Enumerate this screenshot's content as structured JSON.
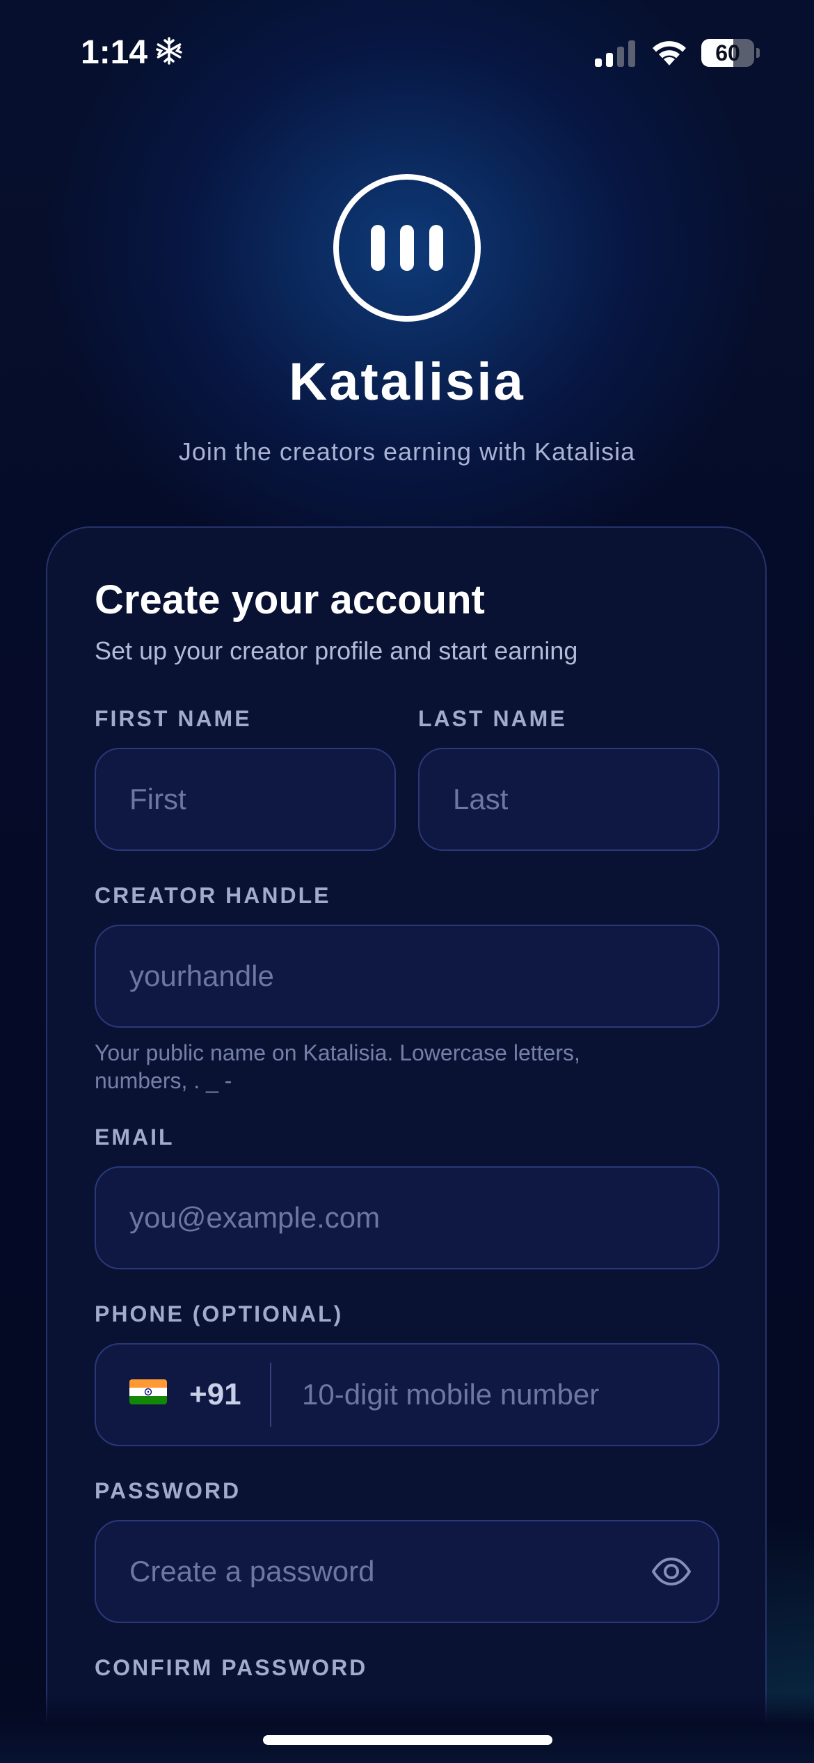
{
  "status_bar": {
    "time": "1:14",
    "battery_level": "60",
    "battery_fraction": 0.6
  },
  "brand": {
    "name": "Katalisia",
    "tagline": "Join the creators earning with Katalisia",
    "logo_icon": "pause-bars-logo-icon"
  },
  "form": {
    "title": "Create your account",
    "subtitle": "Set up your creator profile and start earning",
    "first_name": {
      "label": "FIRST NAME",
      "placeholder": "First",
      "value": ""
    },
    "last_name": {
      "label": "LAST NAME",
      "placeholder": "Last",
      "value": ""
    },
    "handle": {
      "label": "CREATOR HANDLE",
      "placeholder": "yourhandle",
      "value": "",
      "helper": "Your public name on Katalisia. Lowercase letters, numbers, . _ -"
    },
    "email": {
      "label": "EMAIL",
      "placeholder": "you@example.com",
      "value": ""
    },
    "phone": {
      "label": "PHONE (OPTIONAL)",
      "country_flag": "india-flag-icon",
      "dial_code": "+91",
      "placeholder": "10-digit mobile number",
      "value": ""
    },
    "password": {
      "label": "PASSWORD",
      "placeholder": "Create a password",
      "value": "",
      "toggle_icon": "eye-icon"
    },
    "confirm_password": {
      "label": "CONFIRM PASSWORD"
    }
  },
  "colors": {
    "background": "#050a26",
    "card": "#0a1234",
    "input_border": "#2a3878",
    "label": "#a3abca",
    "placeholder": "#6c77a4"
  }
}
